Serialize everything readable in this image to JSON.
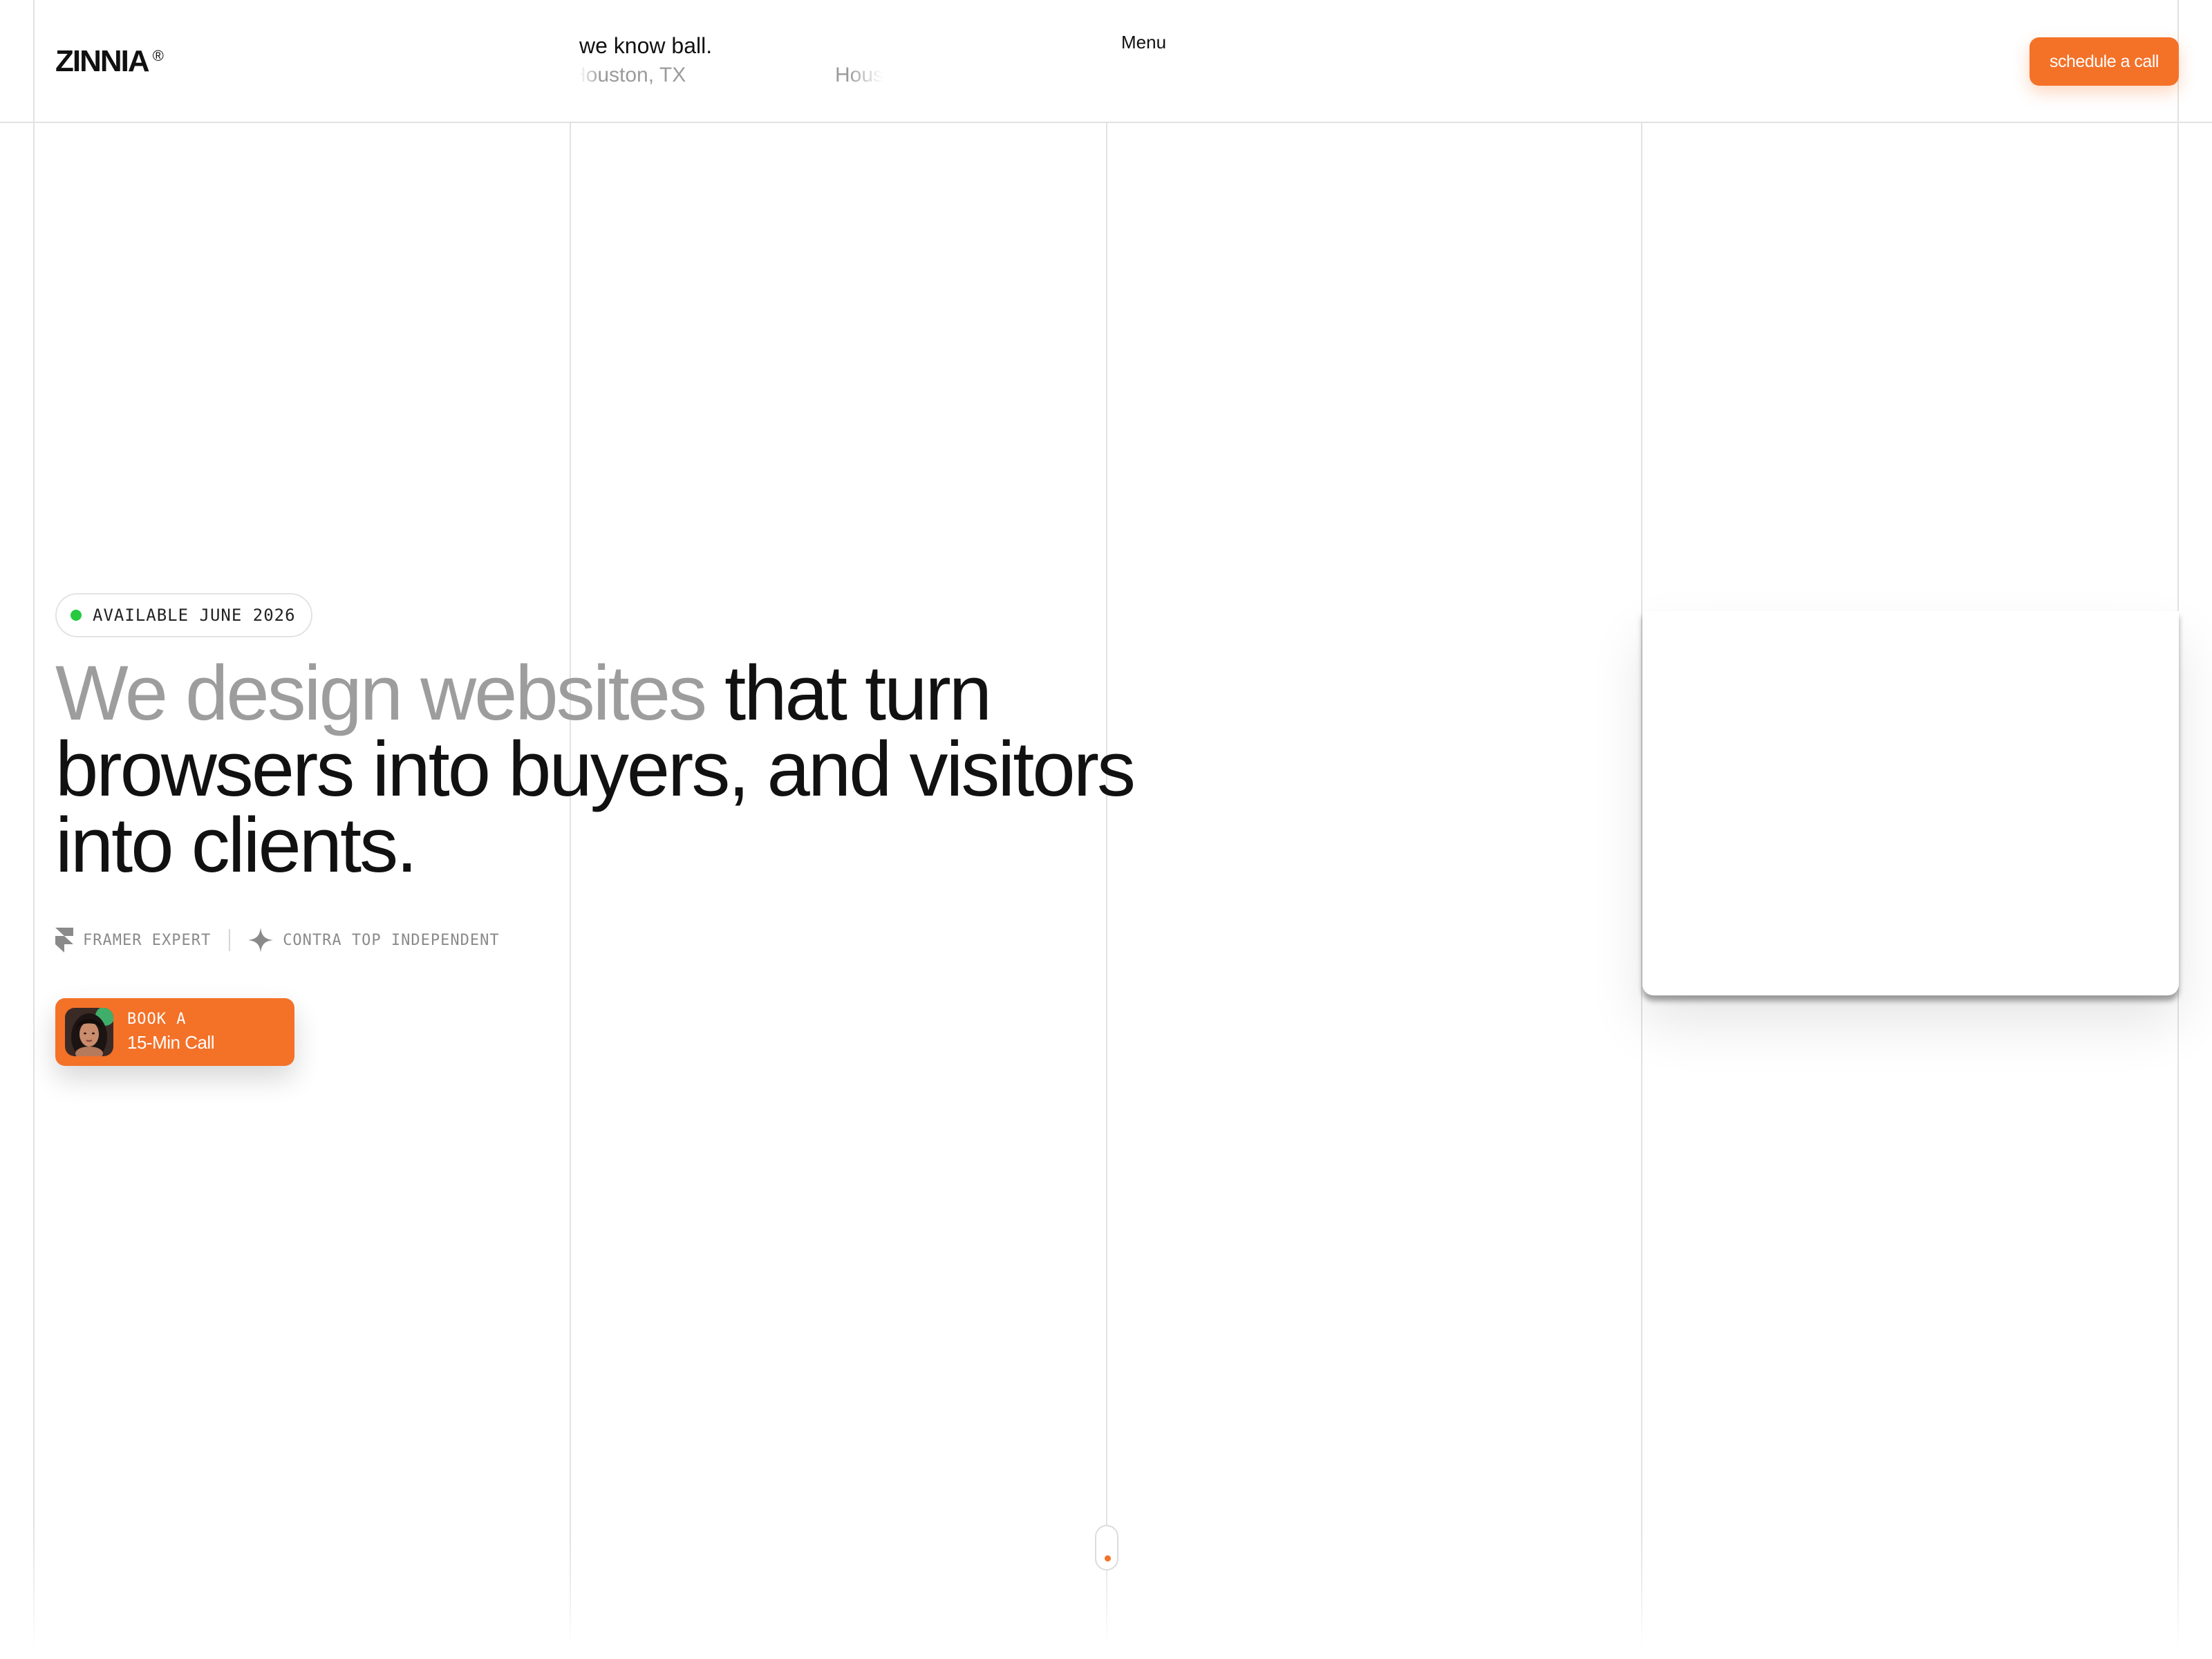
{
  "header": {
    "logo": "ZINNIA",
    "logo_mark": "®",
    "tagline": "we know ball.",
    "locations": [
      "Houston, TX",
      "Houst"
    ],
    "menu_label": "Menu",
    "cta_label": "schedule a call"
  },
  "hero": {
    "badge": "AVAILABLE JUNE 2026",
    "headline_muted": "We design websites",
    "headline_rest": " that turn browsers into buyers, and visitors into clients.",
    "credentials": [
      {
        "icon": "framer-icon",
        "label": "FRAMER EXPERT"
      },
      {
        "icon": "contra-icon",
        "label": "CONTRA TOP INDEPENDENT"
      }
    ],
    "book": {
      "line1": "BOOK A",
      "line2": "15-Min Call"
    }
  },
  "colors": {
    "accent": "#f47128",
    "status_dot": "#27c93f",
    "muted_text": "#9d9d9d",
    "grid_line": "#e2e2e2"
  }
}
